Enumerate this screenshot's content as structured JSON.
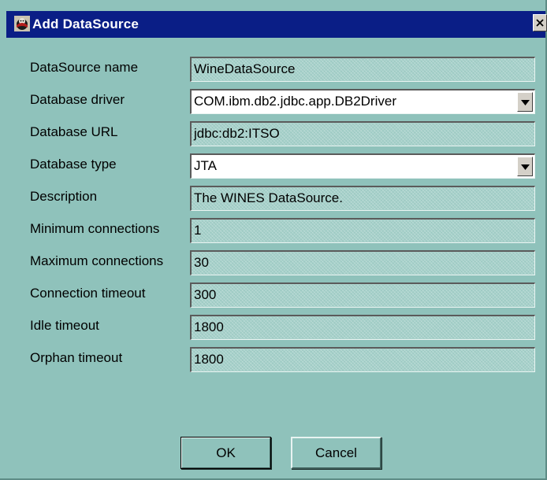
{
  "window": {
    "title": "Add DataSource",
    "icon": "app-icon",
    "close_icon": "close-icon"
  },
  "fields": [
    {
      "label": "DataSource name",
      "value": "WineDataSource",
      "kind": "text"
    },
    {
      "label": "Database driver",
      "value": "COM.ibm.db2.jdbc.app.DB2Driver",
      "kind": "select"
    },
    {
      "label": "Database URL",
      "value": "jdbc:db2:ITSO",
      "kind": "text"
    },
    {
      "label": "Database type",
      "value": "JTA",
      "kind": "select"
    },
    {
      "label": "Description",
      "value": "The WINES DataSource.",
      "kind": "text"
    },
    {
      "label": "Minimum connections",
      "value": "1",
      "kind": "text"
    },
    {
      "label": "Maximum connections",
      "value": "30",
      "kind": "text"
    },
    {
      "label": "Connection timeout",
      "value": "300",
      "kind": "text"
    },
    {
      "label": "Idle timeout",
      "value": "1800",
      "kind": "text"
    },
    {
      "label": "Orphan timeout",
      "value": "1800",
      "kind": "text"
    }
  ],
  "buttons": {
    "ok": "OK",
    "cancel": "Cancel"
  },
  "colors": {
    "dialog_bg": "#8fc2bb",
    "titlebar_bg": "#0a1e86",
    "title_text": "#ffffff"
  }
}
